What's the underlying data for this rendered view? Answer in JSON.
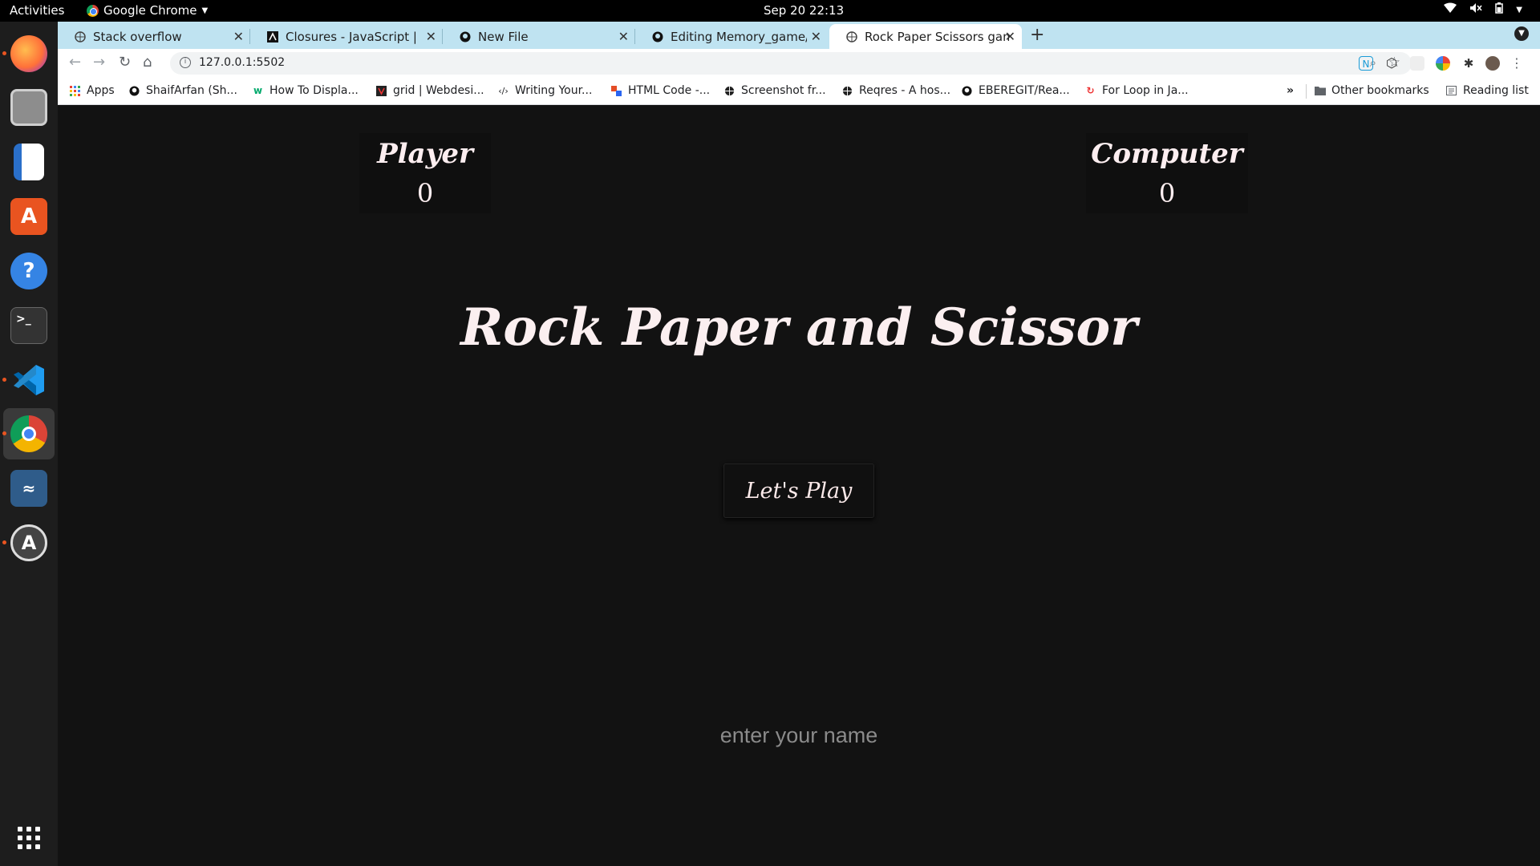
{
  "topbar": {
    "activities": "Activities",
    "app_name": "Google Chrome",
    "clock": "Sep 20  22:13"
  },
  "dock": {
    "items": [
      {
        "name": "firefox-icon"
      },
      {
        "name": "files-icon"
      },
      {
        "name": "writer-icon"
      },
      {
        "name": "software-icon"
      },
      {
        "name": "help-icon"
      },
      {
        "name": "terminal-icon"
      },
      {
        "name": "vscode-icon"
      },
      {
        "name": "chrome-icon"
      },
      {
        "name": "mysql-workbench-icon"
      },
      {
        "name": "updater-icon"
      }
    ]
  },
  "tabs": [
    {
      "label": "Stack overflow"
    },
    {
      "label": "Closures - JavaScript | MD"
    },
    {
      "label": "New File"
    },
    {
      "label": "Editing Memory_game/RE"
    },
    {
      "label": "Rock Paper Scissors game"
    }
  ],
  "toolbar": {
    "url": "127.0.0.1:5502"
  },
  "bookmarks": [
    {
      "label": "Apps"
    },
    {
      "label": "ShaifArfan (Sh..."
    },
    {
      "label": "How To Displa..."
    },
    {
      "label": "grid | Webdesi..."
    },
    {
      "label": "Writing Your..."
    },
    {
      "label": "HTML Code -..."
    },
    {
      "label": "Screenshot fr..."
    },
    {
      "label": "Reqres - A hos..."
    },
    {
      "label": "EBEREGIT/Rea..."
    },
    {
      "label": "For Loop in Ja..."
    }
  ],
  "bookmarks_right": {
    "more": "»",
    "other": "Other bookmarks",
    "reading": "Reading list"
  },
  "game": {
    "player_label": "Player",
    "player_score": "0",
    "computer_label": "Computer",
    "computer_score": "0",
    "title": "Rock Paper and Scissor",
    "play_button": "Let's Play",
    "name_placeholder": "enter your name"
  }
}
